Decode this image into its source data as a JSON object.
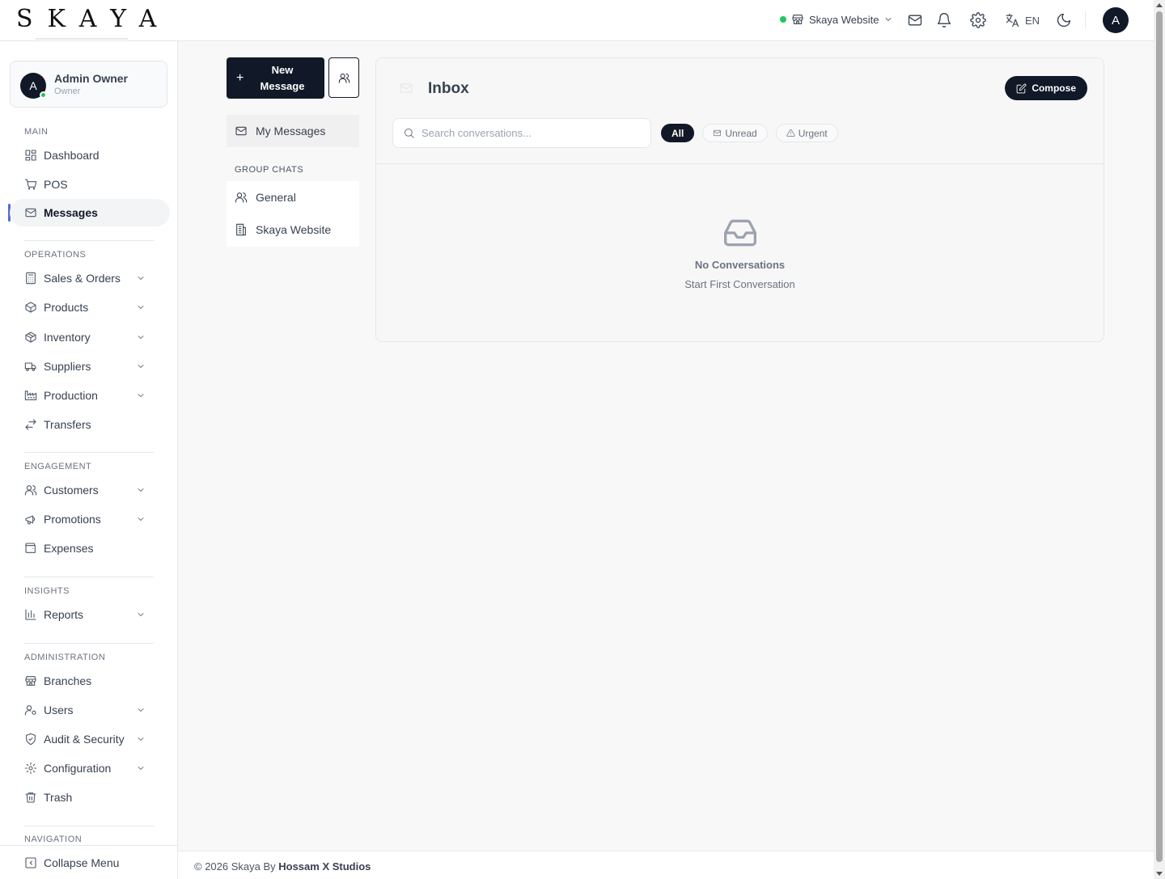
{
  "app": {
    "logo": "SKAYA"
  },
  "header": {
    "branch": "Skaya Website",
    "language": "EN",
    "avatar_initial": "A"
  },
  "user": {
    "name": "Admin Owner",
    "role": "Owner",
    "initial": "A"
  },
  "sidebar": {
    "sections": {
      "main": "MAIN",
      "operations": "OPERATIONS",
      "engagement": "ENGAGEMENT",
      "insights": "INSIGHTS",
      "administration": "ADMINISTRATION",
      "navigation": "NAVIGATION"
    },
    "items": {
      "dashboard": "Dashboard",
      "pos": "POS",
      "messages": "Messages",
      "sales_orders": "Sales & Orders",
      "products": "Products",
      "inventory": "Inventory",
      "suppliers": "Suppliers",
      "production": "Production",
      "transfers": "Transfers",
      "customers": "Customers",
      "promotions": "Promotions",
      "expenses": "Expenses",
      "reports": "Reports",
      "branches": "Branches",
      "users": "Users",
      "audit_security": "Audit & Security",
      "configuration": "Configuration",
      "trash": "Trash",
      "collapse_menu": "Collapse Menu"
    }
  },
  "messages_nav": {
    "new_message": "New Message",
    "my_messages": "My Messages",
    "group_chats_label": "GROUP CHATS",
    "groups": [
      "General",
      "Skaya Website"
    ]
  },
  "inbox": {
    "title": "Inbox",
    "compose": "Compose",
    "search_placeholder": "Search conversations...",
    "filters": {
      "all": "All",
      "unread": "Unread",
      "urgent": "Urgent"
    },
    "empty_title": "No Conversations",
    "empty_subtitle": "Start First Conversation"
  },
  "footer": {
    "prefix": "© 2026 Skaya By ",
    "studio": "Hossam X Studios"
  },
  "colors": {
    "primary": "#111827",
    "online": "#22c55e",
    "active_indicator": "#4f6bdc"
  }
}
